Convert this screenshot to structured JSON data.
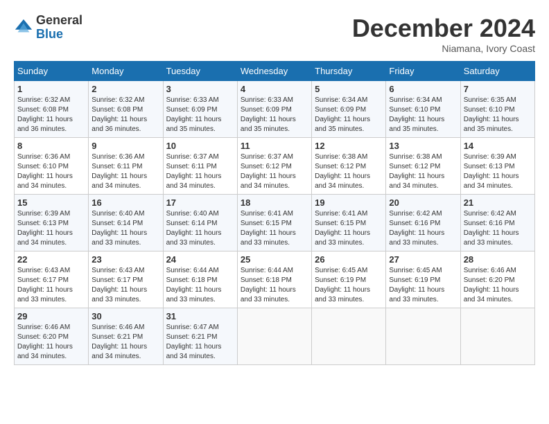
{
  "logo": {
    "general": "General",
    "blue": "Blue"
  },
  "title": "December 2024",
  "location": "Niamana, Ivory Coast",
  "days_of_week": [
    "Sunday",
    "Monday",
    "Tuesday",
    "Wednesday",
    "Thursday",
    "Friday",
    "Saturday"
  ],
  "weeks": [
    [
      {
        "day": "1",
        "sunrise": "6:32 AM",
        "sunset": "6:08 PM",
        "daylight": "11 hours and 36 minutes."
      },
      {
        "day": "2",
        "sunrise": "6:32 AM",
        "sunset": "6:08 PM",
        "daylight": "11 hours and 36 minutes."
      },
      {
        "day": "3",
        "sunrise": "6:33 AM",
        "sunset": "6:09 PM",
        "daylight": "11 hours and 35 minutes."
      },
      {
        "day": "4",
        "sunrise": "6:33 AM",
        "sunset": "6:09 PM",
        "daylight": "11 hours and 35 minutes."
      },
      {
        "day": "5",
        "sunrise": "6:34 AM",
        "sunset": "6:09 PM",
        "daylight": "11 hours and 35 minutes."
      },
      {
        "day": "6",
        "sunrise": "6:34 AM",
        "sunset": "6:10 PM",
        "daylight": "11 hours and 35 minutes."
      },
      {
        "day": "7",
        "sunrise": "6:35 AM",
        "sunset": "6:10 PM",
        "daylight": "11 hours and 35 minutes."
      }
    ],
    [
      {
        "day": "8",
        "sunrise": "6:36 AM",
        "sunset": "6:10 PM",
        "daylight": "11 hours and 34 minutes."
      },
      {
        "day": "9",
        "sunrise": "6:36 AM",
        "sunset": "6:11 PM",
        "daylight": "11 hours and 34 minutes."
      },
      {
        "day": "10",
        "sunrise": "6:37 AM",
        "sunset": "6:11 PM",
        "daylight": "11 hours and 34 minutes."
      },
      {
        "day": "11",
        "sunrise": "6:37 AM",
        "sunset": "6:12 PM",
        "daylight": "11 hours and 34 minutes."
      },
      {
        "day": "12",
        "sunrise": "6:38 AM",
        "sunset": "6:12 PM",
        "daylight": "11 hours and 34 minutes."
      },
      {
        "day": "13",
        "sunrise": "6:38 AM",
        "sunset": "6:12 PM",
        "daylight": "11 hours and 34 minutes."
      },
      {
        "day": "14",
        "sunrise": "6:39 AM",
        "sunset": "6:13 PM",
        "daylight": "11 hours and 34 minutes."
      }
    ],
    [
      {
        "day": "15",
        "sunrise": "6:39 AM",
        "sunset": "6:13 PM",
        "daylight": "11 hours and 34 minutes."
      },
      {
        "day": "16",
        "sunrise": "6:40 AM",
        "sunset": "6:14 PM",
        "daylight": "11 hours and 33 minutes."
      },
      {
        "day": "17",
        "sunrise": "6:40 AM",
        "sunset": "6:14 PM",
        "daylight": "11 hours and 33 minutes."
      },
      {
        "day": "18",
        "sunrise": "6:41 AM",
        "sunset": "6:15 PM",
        "daylight": "11 hours and 33 minutes."
      },
      {
        "day": "19",
        "sunrise": "6:41 AM",
        "sunset": "6:15 PM",
        "daylight": "11 hours and 33 minutes."
      },
      {
        "day": "20",
        "sunrise": "6:42 AM",
        "sunset": "6:16 PM",
        "daylight": "11 hours and 33 minutes."
      },
      {
        "day": "21",
        "sunrise": "6:42 AM",
        "sunset": "6:16 PM",
        "daylight": "11 hours and 33 minutes."
      }
    ],
    [
      {
        "day": "22",
        "sunrise": "6:43 AM",
        "sunset": "6:17 PM",
        "daylight": "11 hours and 33 minutes."
      },
      {
        "day": "23",
        "sunrise": "6:43 AM",
        "sunset": "6:17 PM",
        "daylight": "11 hours and 33 minutes."
      },
      {
        "day": "24",
        "sunrise": "6:44 AM",
        "sunset": "6:18 PM",
        "daylight": "11 hours and 33 minutes."
      },
      {
        "day": "25",
        "sunrise": "6:44 AM",
        "sunset": "6:18 PM",
        "daylight": "11 hours and 33 minutes."
      },
      {
        "day": "26",
        "sunrise": "6:45 AM",
        "sunset": "6:19 PM",
        "daylight": "11 hours and 33 minutes."
      },
      {
        "day": "27",
        "sunrise": "6:45 AM",
        "sunset": "6:19 PM",
        "daylight": "11 hours and 33 minutes."
      },
      {
        "day": "28",
        "sunrise": "6:46 AM",
        "sunset": "6:20 PM",
        "daylight": "11 hours and 34 minutes."
      }
    ],
    [
      {
        "day": "29",
        "sunrise": "6:46 AM",
        "sunset": "6:20 PM",
        "daylight": "11 hours and 34 minutes."
      },
      {
        "day": "30",
        "sunrise": "6:46 AM",
        "sunset": "6:21 PM",
        "daylight": "11 hours and 34 minutes."
      },
      {
        "day": "31",
        "sunrise": "6:47 AM",
        "sunset": "6:21 PM",
        "daylight": "11 hours and 34 minutes."
      },
      null,
      null,
      null,
      null
    ]
  ]
}
